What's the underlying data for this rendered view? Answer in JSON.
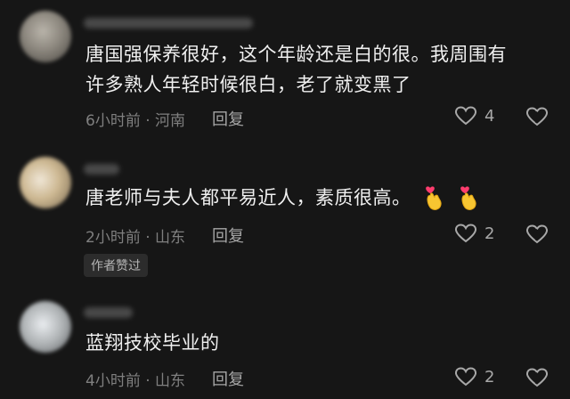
{
  "comments": [
    {
      "text_line1": "唐国强保养很好，这个年龄还是白的很。我周围有",
      "text_line2": "许多熟人年轻时候很白，老了就变黑了",
      "time": "6小时前 · 河南",
      "reply_label": "回复",
      "likes": "4"
    },
    {
      "text": "唐老师与夫人都平易近人，素质很高。",
      "emoji": [
        "heart-hands-emoji",
        "heart-hands-emoji"
      ],
      "time": "2小时前 · 山东",
      "reply_label": "回复",
      "likes": "2",
      "author_badge": "作者赞过"
    },
    {
      "text": "蓝翔技校毕业的",
      "time": "4小时前 · 山东",
      "reply_label": "回复",
      "likes": "2"
    }
  ],
  "colors": {
    "background": "#161616",
    "text": "#f0f0f0",
    "meta": "#7f7f7f",
    "icon": "#a8a8a8"
  },
  "icons": [
    "heart-outline-icon",
    "broken-heart-icon"
  ]
}
